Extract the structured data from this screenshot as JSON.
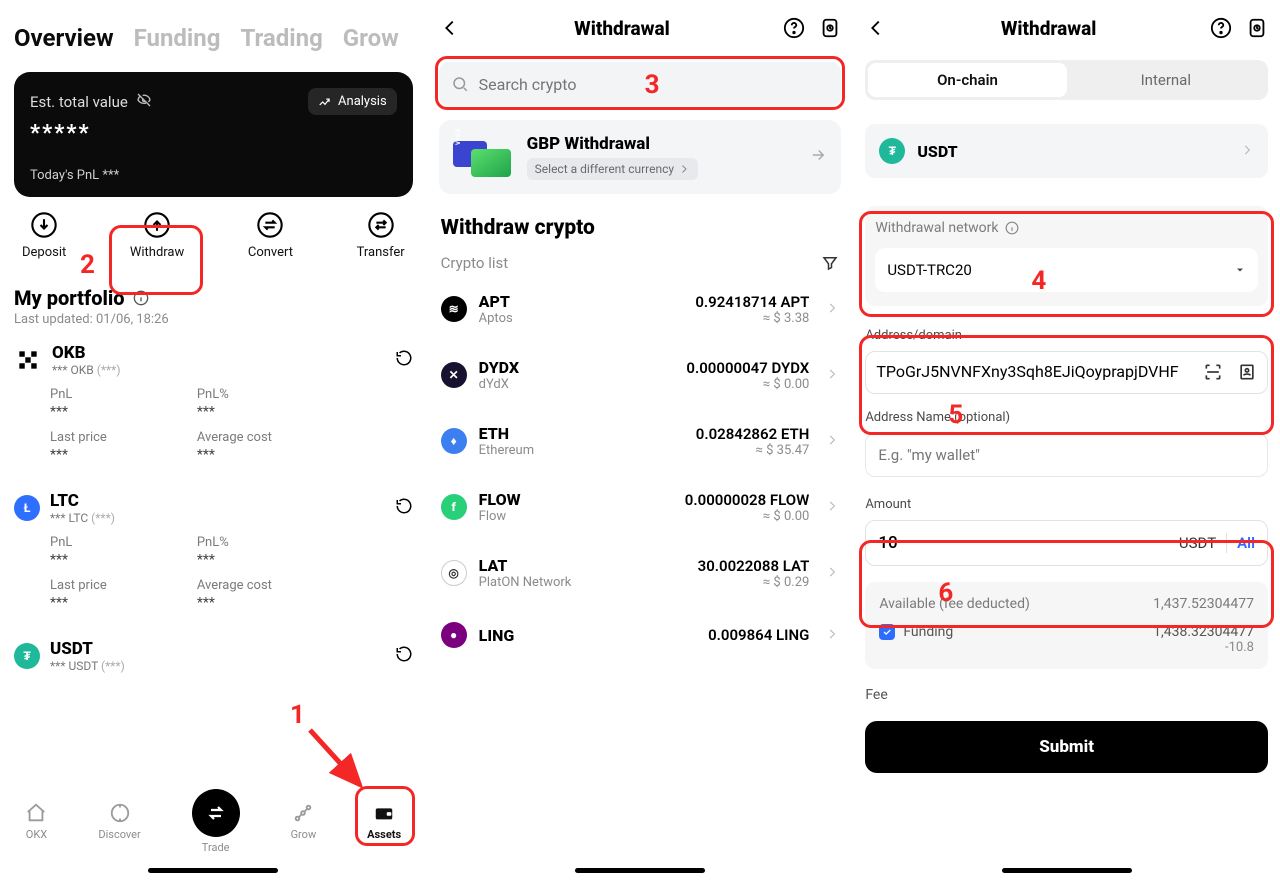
{
  "screen1": {
    "tabs": [
      "Overview",
      "Funding",
      "Trading",
      "Grow"
    ],
    "active_tab": "Overview",
    "est_label": "Est. total value",
    "analysis": "Analysis",
    "masked_value": "*****",
    "pnl_label": "Today's PnL ***",
    "actions": {
      "deposit": "Deposit",
      "withdraw": "Withdraw",
      "convert": "Convert",
      "transfer": "Transfer"
    },
    "portfolio_title": "My portfolio",
    "updated": "Last updated: 01/06, 18:26",
    "stat_labels": {
      "pnl": "PnL",
      "pnlp": "PnL%",
      "last": "Last price",
      "avg": "Average cost"
    },
    "mask": "***",
    "assets": [
      {
        "sym": "OKB",
        "sub1": "*** OKB",
        "sub2": "(***)"
      },
      {
        "sym": "LTC",
        "sub1": "*** LTC",
        "sub2": "(***)"
      },
      {
        "sym": "USDT",
        "sub1": "*** USDT",
        "sub2": "(***)"
      }
    ],
    "nav": [
      "OKX",
      "Discover",
      "Trade",
      "Grow",
      "Assets"
    ]
  },
  "screen2": {
    "title": "Withdrawal",
    "search_placeholder": "Search crypto",
    "gbp_title": "GBP Withdrawal",
    "gbp_sub": "Select a different currency",
    "withdraw_title": "Withdraw crypto",
    "list_label": "Crypto list",
    "rows": [
      {
        "sym": "APT",
        "name": "Aptos",
        "amt": "0.92418714 APT",
        "fiat": "≈ $ 3.38"
      },
      {
        "sym": "DYDX",
        "name": "dYdX",
        "amt": "0.00000047 DYDX",
        "fiat": "≈ $ 0.00"
      },
      {
        "sym": "ETH",
        "name": "Ethereum",
        "amt": "0.02842862 ETH",
        "fiat": "≈ $ 35.47"
      },
      {
        "sym": "FLOW",
        "name": "Flow",
        "amt": "0.00000028 FLOW",
        "fiat": "≈ $ 0.00"
      },
      {
        "sym": "LAT",
        "name": "PlatON Network",
        "amt": "30.0022088 LAT",
        "fiat": "≈ $ 0.29"
      },
      {
        "sym": "LING",
        "name": "",
        "amt": "0.009864 LING",
        "fiat": ""
      }
    ]
  },
  "screen3": {
    "title": "Withdrawal",
    "seg": {
      "onchain": "On-chain",
      "internal": "Internal"
    },
    "coin": "USDT",
    "network_label": "Withdrawal network",
    "network_value": "USDT-TRC20",
    "address_label": "Address/domain",
    "address_value": "TPoGrJ5NVNFXny3Sqh8EJiQoyprapjDVHF",
    "name_label": "Address Name (optional)",
    "name_placeholder": "E.g. \"my wallet\"",
    "amount_label": "Amount",
    "amount_value": "10",
    "amount_sym": "USDT",
    "amount_all": "All",
    "avail_label": "Available (fee deducted)",
    "avail_value": "1,437.52304477",
    "funding_label": "Funding",
    "funding_value": "1,438.32304477",
    "funding_sub": "-10.8",
    "fee_label": "Fee",
    "submit": "Submit"
  },
  "annotations": {
    "n1": "1",
    "n2": "2",
    "n3": "3",
    "n4": "4",
    "n5": "5",
    "n6": "6"
  }
}
